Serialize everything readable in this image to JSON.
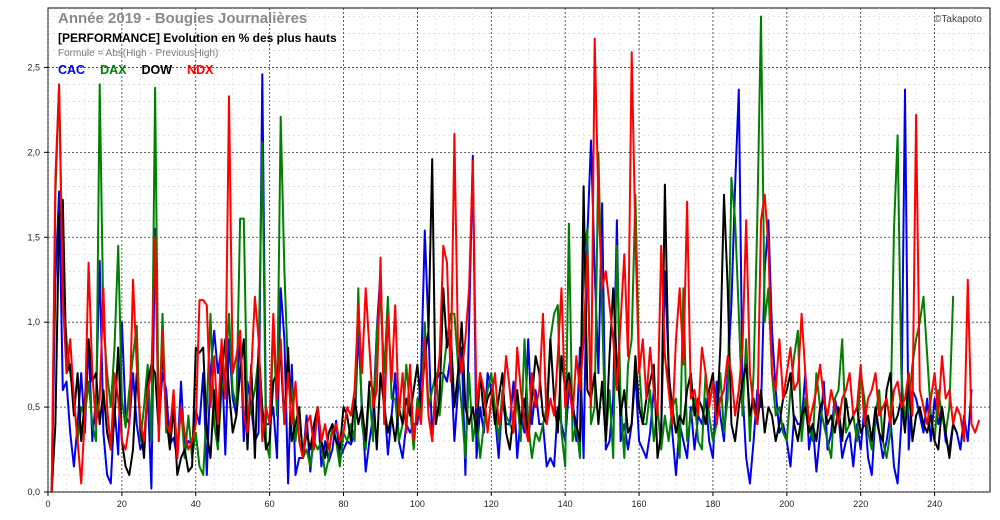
{
  "chart_data": {
    "type": "line",
    "title": "Année 2019 - Bougies Journalières",
    "subtitle": "[PERFORMANCE] Evolution en % des plus hauts",
    "formula": "Formule = Abs(High - PreviousHigh)",
    "watermark": "©Takapoto",
    "xlim": [
      0,
      255
    ],
    "ylim": [
      0,
      2.85
    ],
    "x_ticks": [
      0,
      20,
      40,
      60,
      80,
      100,
      120,
      140,
      160,
      180,
      200,
      220,
      240
    ],
    "y_ticks": [
      0.0,
      0.5,
      1.0,
      1.5,
      2.0,
      2.5
    ],
    "y_tick_labels": [
      "0,0",
      "0,5",
      "1,0",
      "1,5",
      "2,0",
      "2,5"
    ],
    "grid": true,
    "legend_position": "top-left",
    "series": [
      {
        "name": "CAC",
        "color": "#0000ee",
        "values": [
          0,
          1.25,
          1.77,
          0.6,
          0.65,
          0.35,
          0.15,
          0.4,
          0.7,
          0.35,
          0.9,
          0.3,
          0.55,
          1.36,
          0.35,
          0.1,
          0.05,
          0.5,
          0.22,
          1.0,
          0.45,
          0.4,
          0.7,
          0.4,
          0.25,
          0.32,
          0.58,
          0.02,
          1.55,
          0.4,
          0.7,
          0.6,
          0.28,
          0.32,
          0.2,
          0.65,
          0.24,
          0.3,
          0.28,
          0.48,
          0.4,
          0.7,
          0.1,
          0.7,
          0.95,
          0.7,
          0.85,
          0.22,
          0.9,
          0.55,
          0.45,
          0.95,
          0.3,
          0.65,
          0.5,
          0.3,
          0.35,
          2.46,
          0.4,
          0.4,
          0.5,
          0.2,
          1.2,
          0.9,
          0.05,
          0.75,
          0.1,
          0.2,
          0.2,
          0.45,
          0.12,
          0.35,
          0.5,
          0.15,
          0.3,
          0.18,
          0.25,
          0.42,
          0.2,
          0.25,
          0.3,
          0.28,
          0.35,
          0.95,
          0.5,
          0.12,
          0.3,
          0.45,
          0.95,
          1.3,
          0.55,
          0.22,
          0.45,
          0.7,
          0.3,
          0.2,
          0.4,
          0.35,
          0.4,
          0.4,
          0.7,
          1.54,
          0.95,
          0.3,
          0.65,
          0.7,
          0.7,
          0.65,
          0.8,
          0.3,
          0.6,
          0.85,
          0.1,
          0.98,
          1.98,
          0.2,
          0.5,
          0.35,
          0.7,
          0.6,
          0.45,
          0.2,
          0.55,
          0.4,
          0.4,
          0.65,
          0.2,
          0.45,
          0.35,
          0.9,
          0.4,
          0.6,
          0.4,
          0.4,
          0.15,
          0.2,
          0.15,
          0.5,
          0.4,
          0.3,
          0.6,
          0.55,
          0.3,
          0.85,
          0.2,
          1.5,
          2.07,
          1.3,
          0.7,
          1.7,
          0.25,
          0.3,
          0.55,
          1.6,
          0.3,
          0.4,
          0.25,
          0.4,
          0.7,
          0.3,
          0.25,
          0.2,
          0.35,
          0.6,
          0.45,
          0.35,
          1.3,
          0.75,
          0.35,
          0.1,
          0.4,
          0.3,
          0.2,
          0.5,
          0.25,
          0.45,
          0.4,
          0.55,
          0.3,
          0.2,
          0.65,
          0.45,
          0.3,
          0.7,
          1.1,
          1.8,
          2.37,
          0.6,
          0.2,
          0.05,
          0.3,
          0.6,
          0.5,
          1.3,
          1.6,
          0.95,
          0.6,
          0.35,
          0.4,
          0.3,
          0.15,
          0.45,
          0.4,
          0.4,
          0.7,
          0.25,
          0.4,
          0.12,
          0.35,
          0.65,
          0.25,
          0.35,
          0.55,
          0.45,
          0.2,
          0.3,
          0.35,
          0.15,
          0.4,
          0.25,
          0.5,
          0.2,
          0.1,
          0.45,
          0.35,
          0.2,
          0.3,
          0.45,
          0.15,
          0.05,
          0.4,
          2.37,
          0.25,
          0.6,
          0.55,
          0.45,
          0.35,
          0.55,
          0.3,
          0.55,
          0.4,
          0.5,
          0.3,
          0.25,
          0.4,
          0.35,
          0.25,
          0.45,
          0.3,
          0.6
        ]
      },
      {
        "name": "DAX",
        "color": "#008000",
        "values": [
          0,
          1.75,
          2.4,
          1.2,
          0.9,
          0.7,
          0.55,
          0.3,
          0.5,
          0.45,
          0.65,
          0.4,
          0.3,
          2.4,
          1.0,
          0.7,
          0.5,
          0.85,
          1.45,
          0.55,
          0.38,
          0.6,
          0.8,
          0.98,
          0.3,
          0.5,
          0.75,
          0.3,
          2.38,
          0.3,
          1.05,
          0.35,
          0.4,
          0.52,
          0.25,
          0.5,
          0.2,
          0.45,
          0.2,
          0.35,
          0.15,
          0.1,
          0.5,
          1.05,
          0.4,
          0.25,
          0.6,
          0.7,
          1.05,
          0.6,
          0.5,
          1.61,
          1.61,
          0.4,
          0.5,
          0.6,
          0.8,
          2.06,
          0.3,
          0.2,
          1.0,
          0.45,
          2.21,
          1.3,
          0.7,
          0.6,
          0.3,
          0.5,
          0.2,
          0.25,
          0.15,
          0.3,
          0.25,
          0.3,
          0.1,
          0.2,
          0.4,
          0.3,
          0.15,
          0.35,
          0.3,
          0.4,
          0.3,
          1.2,
          0.4,
          0.25,
          0.6,
          0.3,
          0.95,
          1.14,
          0.7,
          1.15,
          0.55,
          0.55,
          0.3,
          0.4,
          0.75,
          0.5,
          0.25,
          0.55,
          0.45,
          1.0,
          0.5,
          0.6,
          0.7,
          0.45,
          0.7,
          0.9,
          1.05,
          1.05,
          0.75,
          0.5,
          0.2,
          0.7,
          0.3,
          0.45,
          0.2,
          0.4,
          0.6,
          0.7,
          0.5,
          0.3,
          0.6,
          0.45,
          0.4,
          0.35,
          0.55,
          0.3,
          0.9,
          0.4,
          0.2,
          0.35,
          0.3,
          0.4,
          0.5,
          0.9,
          1.05,
          1.1,
          0.35,
          0.15,
          1.58,
          0.3,
          0.4,
          0.2,
          1.4,
          1.55,
          0.4,
          0.5,
          2.0,
          1.05,
          0.3,
          0.6,
          0.2,
          1.45,
          0.55,
          0.2,
          0.75,
          0.9,
          1.75,
          0.75,
          0.4,
          0.4,
          0.6,
          0.3,
          0.5,
          0.25,
          0.45,
          0.3,
          0.5,
          0.55,
          0.2,
          1.2,
          0.3,
          0.45,
          0.55,
          0.3,
          0.25,
          0.7,
          0.45,
          0.3,
          0.4,
          0.7,
          0.35,
          0.55,
          1.85,
          1.6,
          1.05,
          0.45,
          0.9,
          0.3,
          0.7,
          1.6,
          2.8,
          1.0,
          1.2,
          0.7,
          0.45,
          0.5,
          0.35,
          0.3,
          0.6,
          0.8,
          0.95,
          0.3,
          0.55,
          0.4,
          0.3,
          0.7,
          0.5,
          0.4,
          0.3,
          0.2,
          0.55,
          0.6,
          0.9,
          0.35,
          0.4,
          0.45,
          0.3,
          0.7,
          0.55,
          0.35,
          0.25,
          0.45,
          0.6,
          0.3,
          0.2,
          0.35,
          1.55,
          2.1,
          0.7,
          0.4,
          0.5,
          0.75,
          0.9,
          1.0,
          1.15,
          0.8,
          0.45,
          0.3,
          0.6,
          0.45,
          0.35,
          0.5,
          1.15
        ]
      },
      {
        "name": "DOW",
        "color": "#000000",
        "values": [
          0,
          0.4,
          1.62,
          1.72,
          0.7,
          0.75,
          0.45,
          0.7,
          0.3,
          0.55,
          0.9,
          0.65,
          0.7,
          0.4,
          0.6,
          0.35,
          0.25,
          0.42,
          0.85,
          0.3,
          0.15,
          0.1,
          0.25,
          0.7,
          0.4,
          0.2,
          0.65,
          0.75,
          0.7,
          0.35,
          0.85,
          0.45,
          0.25,
          0.5,
          0.1,
          0.2,
          0.25,
          0.12,
          0.15,
          0.85,
          0.82,
          0.85,
          0.35,
          0.2,
          0.6,
          0.3,
          0.7,
          0.9,
          0.6,
          0.35,
          0.45,
          0.7,
          0.9,
          0.25,
          0.75,
          0.2,
          0.85,
          0.5,
          0.25,
          0.3,
          0.65,
          0.7,
          0.8,
          0.4,
          0.85,
          0.3,
          0.4,
          0.5,
          0.2,
          0.35,
          0.25,
          0.4,
          0.5,
          0.3,
          0.2,
          0.35,
          0.4,
          0.3,
          0.25,
          0.5,
          0.45,
          0.3,
          0.55,
          0.4,
          0.5,
          0.3,
          0.65,
          0.6,
          0.25,
          0.7,
          0.5,
          0.35,
          0.45,
          0.3,
          0.5,
          0.4,
          0.55,
          0.45,
          0.6,
          0.75,
          0.5,
          0.8,
          0.95,
          1.96,
          0.4,
          0.55,
          1.2,
          0.85,
          0.95,
          0.5,
          0.7,
          1.0,
          0.5,
          0.4,
          0.5,
          0.35,
          0.7,
          0.45,
          0.55,
          0.6,
          0.4,
          0.55,
          0.7,
          0.35,
          0.25,
          0.45,
          0.6,
          0.4,
          0.55,
          0.3,
          0.55,
          0.8,
          0.7,
          0.45,
          0.4,
          0.9,
          0.55,
          0.35,
          0.8,
          0.6,
          0.7,
          0.5,
          0.4,
          0.3,
          1.8,
          0.6,
          0.55,
          0.7,
          0.4,
          0.65,
          0.3,
          0.8,
          1.2,
          0.75,
          0.45,
          0.6,
          0.35,
          0.4,
          0.8,
          0.5,
          0.4,
          0.55,
          0.65,
          0.75,
          0.2,
          0.35,
          1.81,
          0.7,
          0.5,
          0.35,
          0.45,
          0.4,
          0.6,
          0.7,
          0.45,
          0.55,
          0.5,
          0.4,
          0.6,
          0.7,
          0.4,
          0.85,
          1.75,
          1.2,
          0.4,
          0.3,
          0.5,
          0.65,
          0.75,
          0.45,
          0.55,
          0.4,
          0.6,
          0.35,
          0.5,
          0.45,
          0.3,
          0.4,
          0.55,
          0.6,
          0.7,
          0.4,
          0.3,
          0.45,
          0.5,
          0.35,
          0.4,
          0.3,
          0.5,
          0.55,
          0.4,
          0.45,
          0.35,
          0.5,
          0.3,
          0.55,
          0.4,
          0.45,
          0.5,
          0.35,
          0.4,
          0.45,
          0.3,
          0.5,
          0.35,
          0.3,
          0.6,
          0.7,
          0.4,
          0.45,
          0.55,
          0.35,
          0.7,
          0.3,
          0.45,
          0.5,
          0.4,
          0.35,
          0.45,
          0.3,
          0.25,
          0.5,
          0.35,
          0.2,
          0.4,
          0.35
        ]
      },
      {
        "name": "NDX",
        "color": "#ff0000",
        "values": [
          0,
          1.85,
          2.4,
          1.15,
          0.7,
          0.9,
          0.55,
          0.3,
          0.05,
          0.45,
          1.35,
          0.7,
          0.4,
          0.55,
          1.2,
          0.5,
          0.25,
          0.7,
          0.55,
          0.3,
          0.25,
          0.4,
          1.25,
          0.75,
          0.4,
          0.3,
          0.6,
          0.7,
          1.5,
          0.3,
          0.95,
          0.4,
          0.35,
          0.6,
          0.2,
          0.5,
          0.35,
          0.25,
          0.3,
          0.4,
          1.13,
          1.13,
          1.1,
          0.5,
          0.8,
          0.4,
          0.9,
          0.55,
          2.33,
          0.7,
          0.8,
          0.95,
          0.45,
          0.35,
          0.7,
          1.15,
          0.9,
          0.3,
          0.5,
          0.4,
          1.05,
          0.55,
          0.9,
          0.4,
          0.7,
          0.4,
          0.65,
          0.3,
          0.2,
          0.4,
          0.45,
          0.25,
          0.5,
          0.3,
          0.4,
          0.25,
          0.35,
          0.4,
          0.3,
          0.35,
          0.5,
          0.45,
          0.6,
          1.1,
          0.7,
          1.2,
          0.85,
          0.5,
          0.6,
          1.38,
          0.4,
          1.05,
          0.65,
          1.1,
          0.45,
          0.7,
          0.35,
          0.75,
          0.3,
          0.5,
          0.4,
          0.9,
          0.45,
          0.3,
          0.6,
          0.8,
          1.45,
          1.35,
          0.65,
          2.11,
          0.85,
          0.7,
          0.9,
          1.2,
          1.95,
          0.5,
          0.7,
          0.6,
          0.35,
          0.55,
          0.7,
          0.4,
          0.5,
          0.8,
          0.6,
          0.35,
          0.85,
          0.6,
          0.4,
          0.3,
          0.7,
          0.5,
          0.6,
          1.05,
          0.4,
          0.55,
          0.45,
          0.8,
          1.2,
          0.5,
          0.65,
          0.45,
          0.8,
          0.6,
          0.9,
          1.4,
          0.5,
          2.67,
          1.7,
          1.2,
          1.3,
          1.1,
          0.9,
          0.6,
          1.0,
          1.4,
          0.8,
          2.59,
          1.5,
          0.7,
          0.9,
          0.55,
          0.85,
          0.6,
          0.45,
          1.45,
          0.8,
          0.6,
          0.4,
          0.9,
          1.2,
          0.75,
          1.71,
          0.55,
          0.6,
          0.45,
          0.85,
          0.7,
          0.5,
          0.65,
          0.4,
          0.55,
          0.6,
          0.8,
          0.7,
          0.45,
          0.6,
          0.85,
          1.6,
          0.7,
          0.5,
          0.4,
          1.6,
          1.75,
          1.45,
          0.7,
          0.6,
          0.9,
          0.55,
          0.7,
          0.85,
          0.6,
          0.65,
          1.05,
          0.7,
          0.4,
          0.5,
          0.6,
          0.75,
          0.55,
          0.45,
          0.6,
          0.5,
          0.4,
          0.55,
          0.6,
          0.7,
          0.45,
          0.5,
          0.75,
          0.4,
          0.55,
          0.6,
          0.7,
          0.45,
          0.5,
          0.55,
          0.4,
          0.6,
          0.65,
          0.5,
          0.55,
          0.7,
          0.45,
          2.22,
          0.6,
          0.5,
          0.4,
          0.55,
          0.7,
          0.45,
          0.8,
          0.55,
          0.6,
          0.4,
          0.5,
          0.45,
          0.3,
          1.25,
          0.4,
          0.35,
          0.42
        ]
      }
    ]
  }
}
